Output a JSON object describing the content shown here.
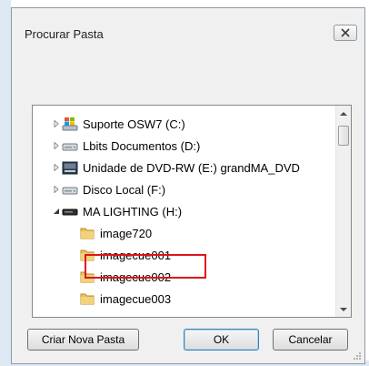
{
  "dialog": {
    "title": "Procurar Pasta"
  },
  "tree": {
    "items": [
      {
        "label": "Suporte OSW7 (C:)",
        "icon": "system-drive-icon",
        "expander": "collapsed"
      },
      {
        "label": "Lbits Documentos (D:)",
        "icon": "hard-drive-icon",
        "expander": "collapsed"
      },
      {
        "label": "Unidade de DVD-RW (E:) grandMA_DVD",
        "icon": "dvd-drive-icon",
        "expander": "collapsed"
      },
      {
        "label": "Disco Local (F:)",
        "icon": "hard-drive-icon",
        "expander": "collapsed"
      },
      {
        "label": "MA LIGHTING (H:)",
        "icon": "removable-drive-icon",
        "expander": "expanded"
      },
      {
        "label": "image720",
        "icon": "folder-icon",
        "expander": "none"
      },
      {
        "label": "imagecue001",
        "icon": "folder-icon",
        "expander": "none",
        "highlighted": true
      },
      {
        "label": "imagecue002",
        "icon": "folder-icon",
        "expander": "none"
      },
      {
        "label": "imagecue003",
        "icon": "folder-icon",
        "expander": "none"
      }
    ]
  },
  "buttons": {
    "new_folder": "Criar Nova Pasta",
    "ok": "OK",
    "cancel": "Cancelar"
  },
  "colors": {
    "highlight": "#e0141b",
    "folder": "#e8c15a",
    "window_bg": "#f0f0f0"
  }
}
